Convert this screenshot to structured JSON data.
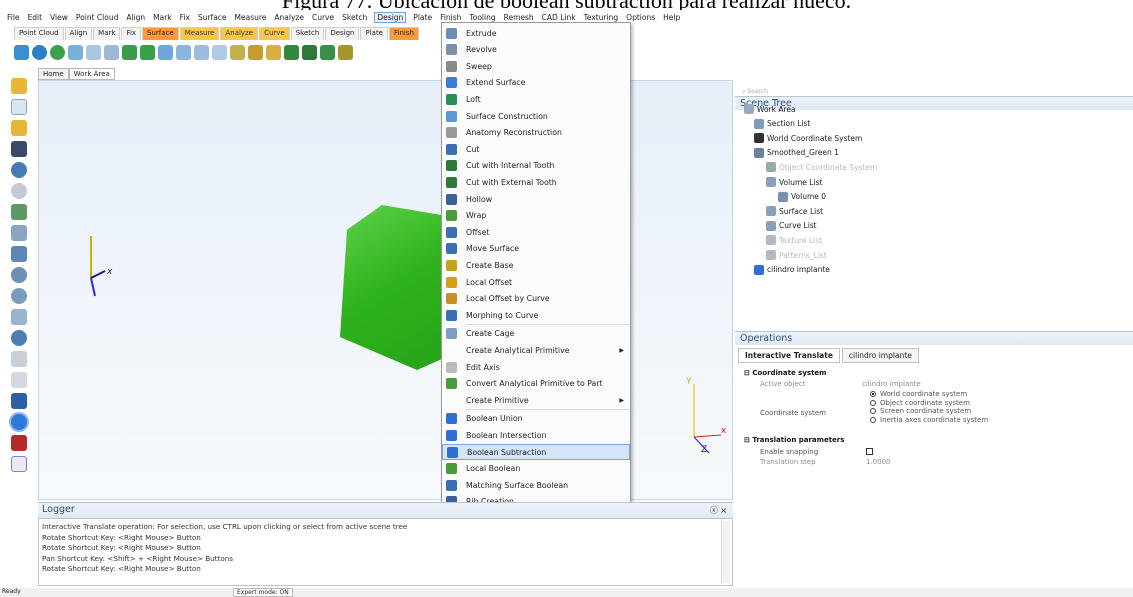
{
  "caption": "Figura 77. Ubicación de boolean subtraction para realizar hueco.",
  "menubar": [
    "File",
    "Edit",
    "View",
    "Point Cloud",
    "Align",
    "Mark",
    "Fix",
    "Surface",
    "Measure",
    "Analyze",
    "Curve",
    "Sketch",
    "Design",
    "Plate",
    "Finish",
    "Tooling",
    "Remesh",
    "CAD Link",
    "Texturing",
    "Options",
    "Help"
  ],
  "menubar_active": "Design",
  "ribbon_tabs": [
    "Point Cloud",
    "Align",
    "Mark",
    "Fix",
    "Surface",
    "Measure",
    "Analyze",
    "Curve",
    "Sketch",
    "Design",
    "Plate",
    "Finish"
  ],
  "viewport_tabs": [
    "Home",
    "Work Area"
  ],
  "design_menu": [
    {
      "label": "Extrude",
      "icon": "extrude-icon",
      "color": "#6c8fb8"
    },
    {
      "label": "Revolve",
      "icon": "revolve-icon",
      "color": "#7d8fa6"
    },
    {
      "label": "Sweep",
      "icon": "sweep-icon",
      "color": "#8a8a8a"
    },
    {
      "label": "Extend Surface",
      "icon": "extend-surface-icon",
      "color": "#3a7bd5"
    },
    {
      "label": "Loft",
      "icon": "loft-icon",
      "color": "#2e8b57"
    },
    {
      "label": "Surface Construction",
      "icon": "surface-construction-icon",
      "color": "#5a9bd4"
    },
    {
      "label": "Anatomy Reconstruction",
      "icon": "anatomy-reconstruction-icon",
      "color": "#999999"
    },
    {
      "label": "Cut",
      "icon": "cut-icon",
      "color": "#3a6fb0"
    },
    {
      "label": "Cut with Internal Tooth",
      "icon": "cut-internal-tooth-icon",
      "color": "#2f7a3a"
    },
    {
      "label": "Cut with External Tooth",
      "icon": "cut-external-tooth-icon",
      "color": "#2f7a3a"
    },
    {
      "label": "Hollow",
      "icon": "hollow-icon",
      "color": "#3c5f9e"
    },
    {
      "label": "Wrap",
      "icon": "wrap-icon",
      "color": "#4a9b3a"
    },
    {
      "label": "Offset",
      "icon": "offset-icon",
      "color": "#3a6fb0"
    },
    {
      "label": "Move Surface",
      "icon": "move-surface-icon",
      "color": "#3a6fb0"
    },
    {
      "label": "Create Base",
      "icon": "create-base-icon",
      "color": "#c8a020"
    },
    {
      "label": "Local Offset",
      "icon": "local-offset-icon",
      "color": "#d4a017"
    },
    {
      "label": "Local Offset by Curve",
      "icon": "local-offset-curve-icon",
      "color": "#c89020"
    },
    {
      "label": "Morphing to Curve",
      "icon": "morphing-curve-icon",
      "color": "#3a6fb0"
    },
    {
      "label": "Create Cage",
      "icon": "create-cage-icon",
      "color": "#7f9fc0"
    },
    {
      "label": "Create Analytical Primitive",
      "icon": "",
      "color": "",
      "submenu": true
    },
    {
      "label": "Edit Axis",
      "icon": "edit-axis-icon",
      "color": "#bbbbbb"
    },
    {
      "label": "Convert Analytical Primitive to Part",
      "icon": "convert-primitive-icon",
      "color": "#4a9b3a"
    },
    {
      "label": "Create Primitive",
      "icon": "",
      "color": "",
      "submenu": true
    },
    {
      "label": "Boolean Union",
      "icon": "boolean-union-icon",
      "color": "#2f6fd0"
    },
    {
      "label": "Boolean Intersection",
      "icon": "boolean-intersection-icon",
      "color": "#2f6fd0"
    },
    {
      "label": "Boolean Subtraction",
      "icon": "boolean-subtraction-icon",
      "color": "#2f6fd0",
      "selected": true
    },
    {
      "label": "Local Boolean",
      "icon": "local-boolean-icon",
      "color": "#4a9b3a"
    },
    {
      "label": "Matching Surface Boolean",
      "icon": "matching-surface-boolean-icon",
      "color": "#3a6fb0"
    },
    {
      "label": "Rib Creation",
      "icon": "rib-creation-icon",
      "color": "#3c5f9e"
    }
  ],
  "scene_tree": {
    "title": "Scene Tree",
    "search_placeholder": "Search",
    "items": [
      {
        "label": "Work Area",
        "dim": false
      },
      {
        "label": "Section List",
        "dim": false
      },
      {
        "label": "World Coordinate System",
        "dim": false
      },
      {
        "label": "Smoothed_Green 1",
        "dim": false
      },
      {
        "label": "Object Coordinate System",
        "dim": true
      },
      {
        "label": "Volume List",
        "dim": false
      },
      {
        "label": "Volume 0",
        "dim": false
      },
      {
        "label": "Surface List",
        "dim": false
      },
      {
        "label": "Curve List",
        "dim": false
      },
      {
        "label": "Texture List",
        "dim": true
      },
      {
        "label": "Patterns_List",
        "dim": true
      },
      {
        "label": "cilindro implante",
        "dim": false
      }
    ]
  },
  "operations": {
    "title": "Operations",
    "tabs": [
      "Interactive Translate",
      "cilindro implante"
    ],
    "coord_section": "Coordinate system",
    "active_object_label": "Active object",
    "active_object_value": "cilindro implante",
    "coord_system_label": "Coordinate system",
    "coord_options": [
      "World coordinate system",
      "Object coordinate system",
      "Screen coordinate system",
      "Inertia axes coordinate system"
    ],
    "translation_section": "Translation parameters",
    "enable_snapping_label": "Enable snapping",
    "translation_step_label": "Translation step",
    "translation_step_value": "1.0000"
  },
  "logger": {
    "title": "Logger",
    "lines": [
      "Interactive Translate operation: For selection, use CTRL upon clicking or select from active scene tree",
      "Rotate Shortcut Key: <Right Mouse> Button",
      "Rotate Shortcut Key: <Right Mouse> Button",
      "Pan Shortcut Key: <Shift> + <Right Mouse> Buttons",
      "Rotate Shortcut Key: <Right Mouse> Button"
    ]
  },
  "status": {
    "left": "Ready",
    "mode": "Expert mode: ON"
  },
  "axes": {
    "x": "x",
    "y": "Y",
    "z": "Z"
  },
  "colors": {
    "accent": "#d4e5f8",
    "cube": "#2fb21e",
    "panel_title": "#2b4f7a"
  }
}
